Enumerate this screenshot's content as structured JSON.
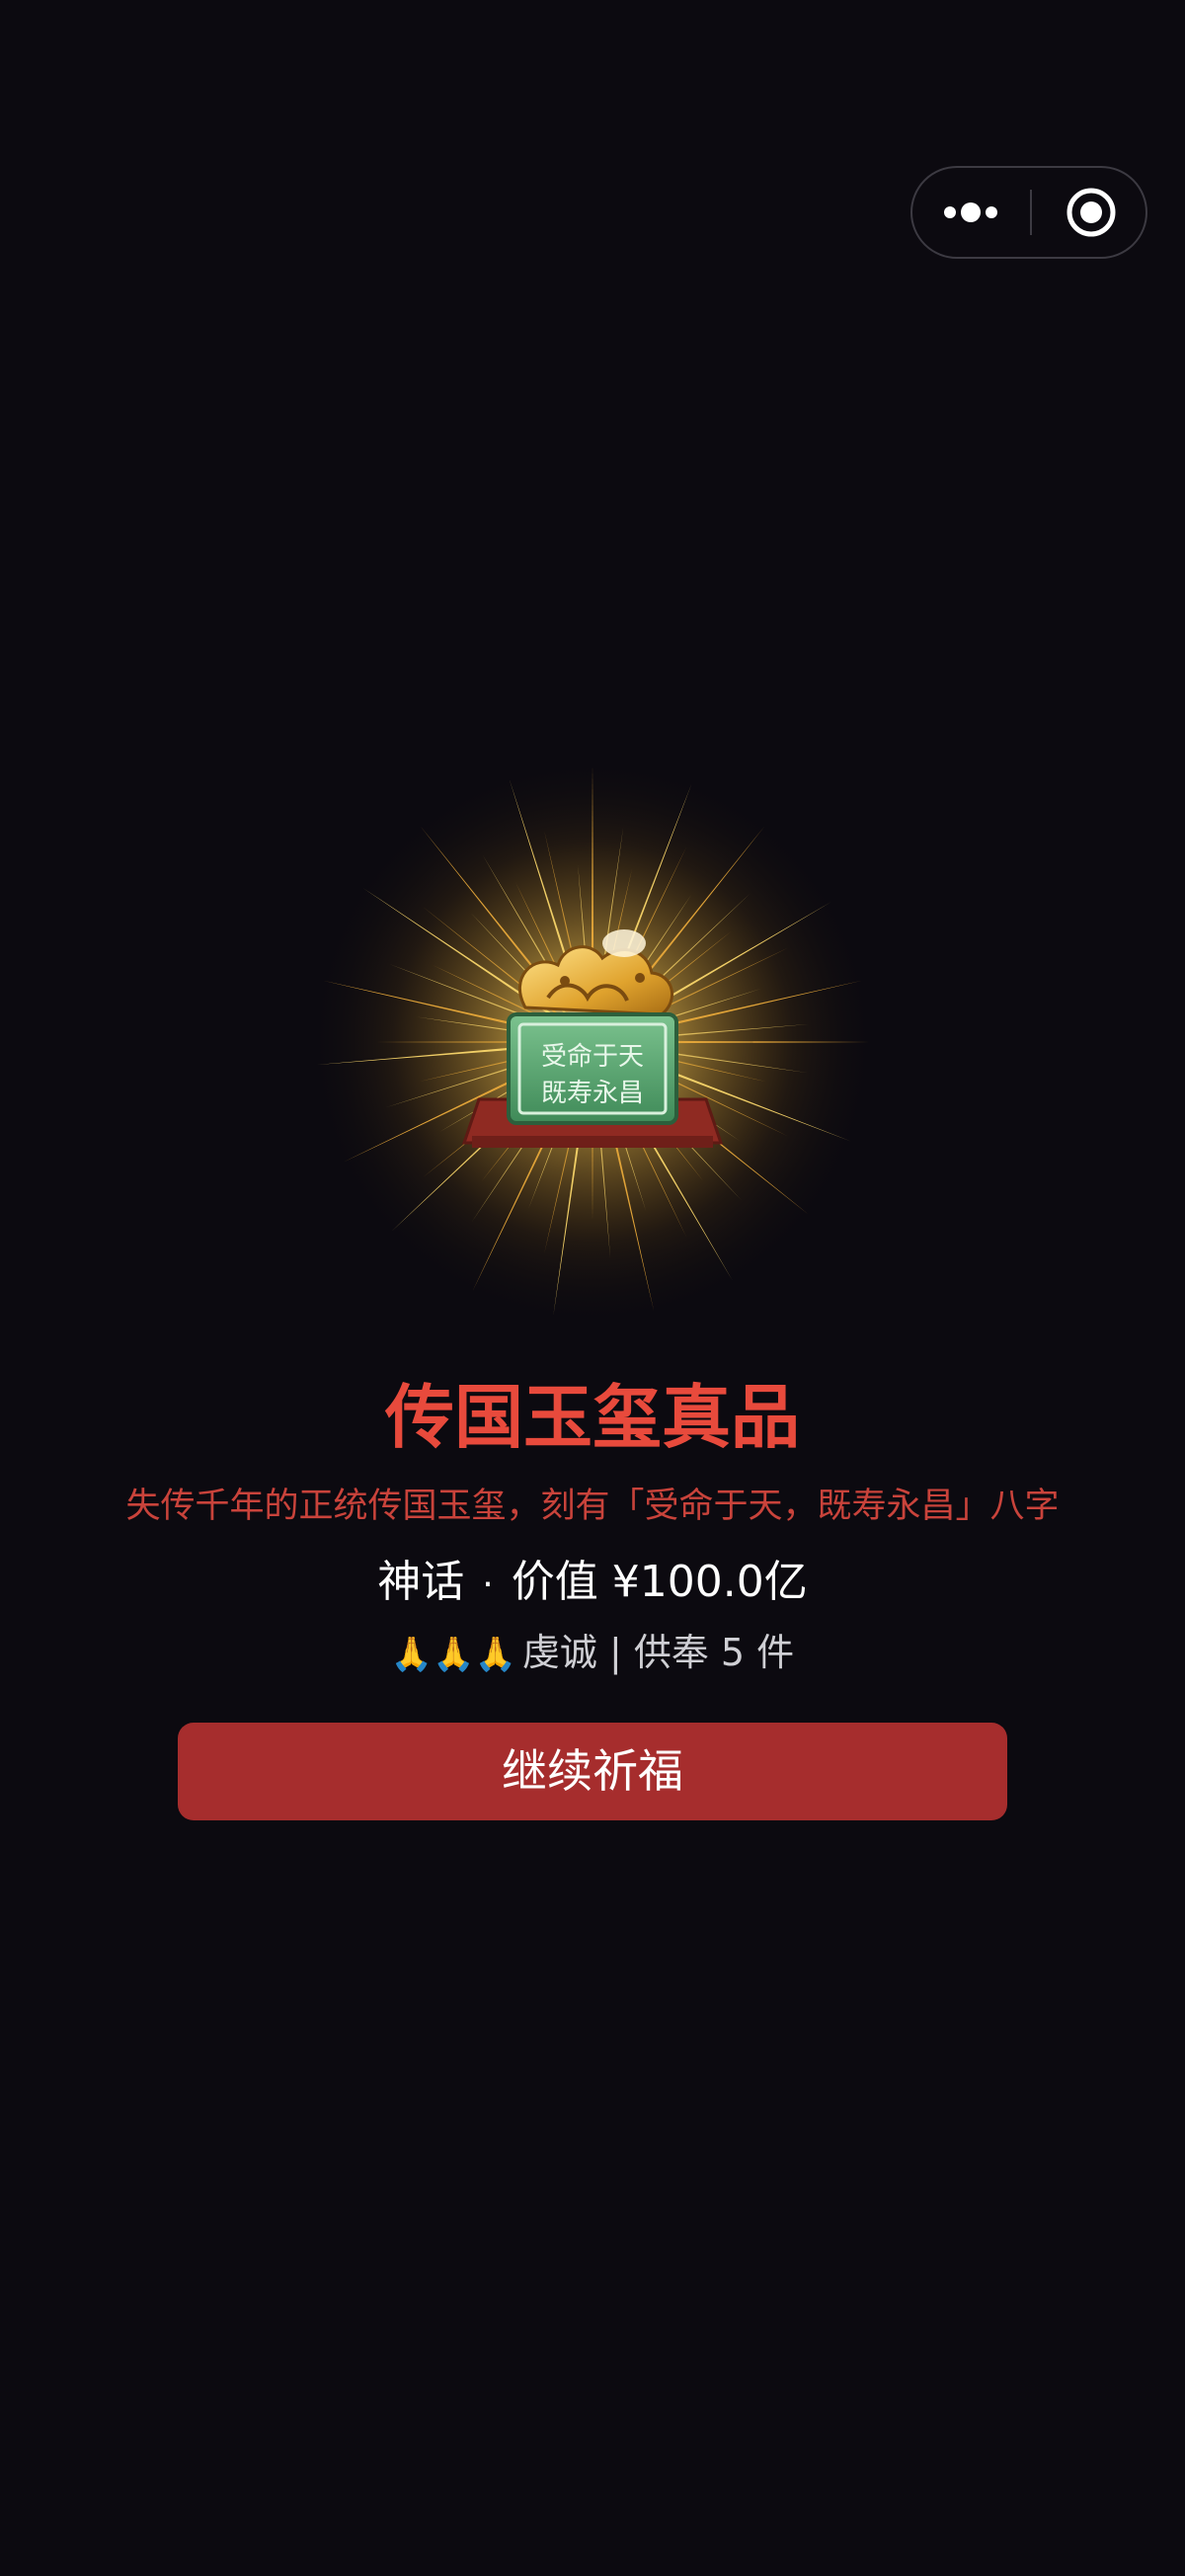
{
  "header": {
    "capsule": {
      "more_icon": "more-dots-icon",
      "close_icon": "target-close-icon"
    }
  },
  "artifact": {
    "name": "传国玉玺真品",
    "description": "失传千年的正统传国玉玺，刻有「受命于天，既寿永昌」八字",
    "inscription_line1": "受命于天",
    "inscription_line2": "既寿永昌",
    "rarity": "神话",
    "separator": "·",
    "value_text": "价值 ¥100.0亿",
    "devotion_emoji": "🙏🙏🙏",
    "devotion_text": "虔诚 | 供奉 5 件",
    "image_icon": "jade-seal-icon"
  },
  "actions": {
    "continue_label": "继续祈福"
  },
  "colors": {
    "background": "#0c0a10",
    "title": "#e84a3c",
    "description": "#c9433b",
    "button": "#a62d2d",
    "jade": "#4fa06a",
    "gold": "#f5c24a"
  }
}
